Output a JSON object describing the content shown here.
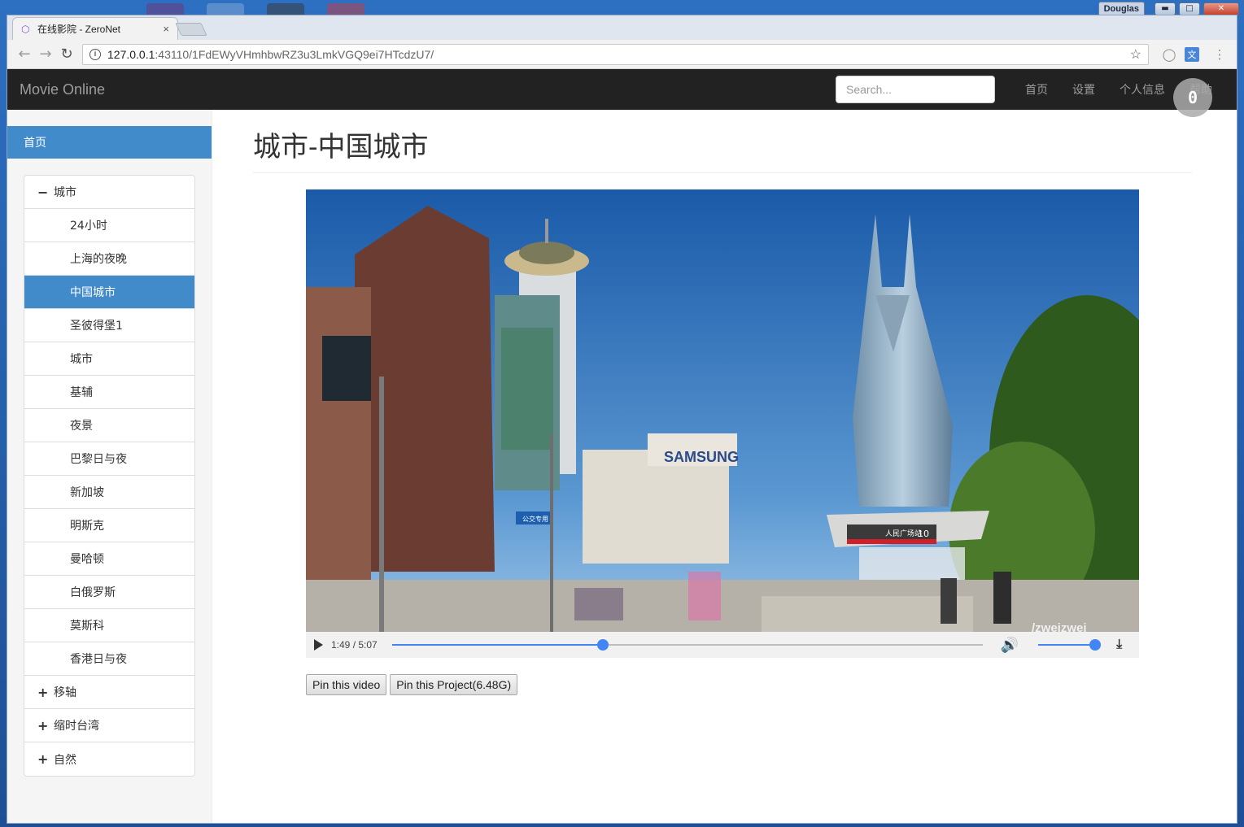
{
  "os": {
    "user": "Douglas",
    "min_label": "▬",
    "max_label": "□",
    "close_label": "✕"
  },
  "browser": {
    "tab_title": "在线影院 - ZeroNet",
    "tab_close": "×",
    "url_host": "127.0.0.1",
    "url_path": ":43110/1FdEWyVHmhbwRZ3u3LmkVGQ9ei7HTcdzU7/"
  },
  "navbar": {
    "brand": "Movie Online",
    "search_placeholder": "Search...",
    "links": [
      "首页",
      "设置",
      "个人信息",
      "帮助"
    ],
    "badge": "0"
  },
  "sidebar": {
    "home": "首页",
    "groups": [
      {
        "label": "城市",
        "expanded": true,
        "items": [
          "24小时",
          "上海的夜晚",
          "中国城市",
          "圣彼得堡1",
          "城市",
          "基辅",
          "夜景",
          "巴黎日与夜",
          "新加坡",
          "明斯克",
          "曼哈顿",
          "白俄罗斯",
          "莫斯科",
          "香港日与夜"
        ],
        "active_item": "中国城市"
      },
      {
        "label": "移轴",
        "expanded": false
      },
      {
        "label": "缩时台湾",
        "expanded": false
      },
      {
        "label": "自然",
        "expanded": false
      }
    ]
  },
  "main": {
    "title": "城市-中国城市",
    "video": {
      "time": "1:49 / 5:07",
      "progress_fraction": 0.357,
      "volume_fraction": 1.0,
      "watermark": "/zweizwei",
      "scene_texts": [
        "SAMSUNG",
        "公交专用",
        "人民广场站",
        "10"
      ]
    },
    "buttons": {
      "pin_video": "Pin this video",
      "pin_project": "Pin this Project(6.48G)"
    }
  },
  "colors": {
    "navbar_bg": "#222222",
    "accent": "#428bca",
    "player_blue": "#4285f4"
  }
}
